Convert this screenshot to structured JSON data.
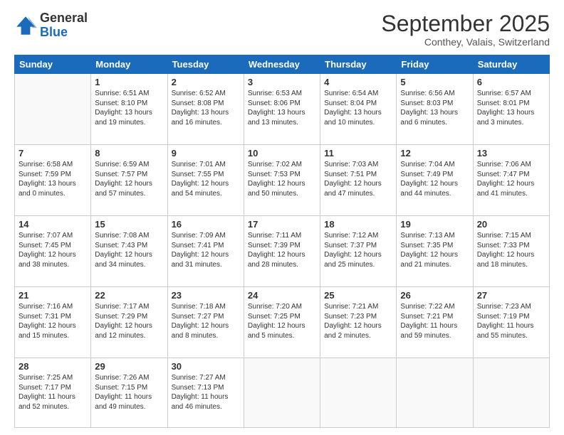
{
  "logo": {
    "general": "General",
    "blue": "Blue"
  },
  "header": {
    "month": "September 2025",
    "location": "Conthey, Valais, Switzerland"
  },
  "days": [
    "Sunday",
    "Monday",
    "Tuesday",
    "Wednesday",
    "Thursday",
    "Friday",
    "Saturday"
  ],
  "weeks": [
    [
      {
        "num": "",
        "sunrise": "",
        "sunset": "",
        "daylight": ""
      },
      {
        "num": "1",
        "sunrise": "Sunrise: 6:51 AM",
        "sunset": "Sunset: 8:10 PM",
        "daylight": "Daylight: 13 hours and 19 minutes."
      },
      {
        "num": "2",
        "sunrise": "Sunrise: 6:52 AM",
        "sunset": "Sunset: 8:08 PM",
        "daylight": "Daylight: 13 hours and 16 minutes."
      },
      {
        "num": "3",
        "sunrise": "Sunrise: 6:53 AM",
        "sunset": "Sunset: 8:06 PM",
        "daylight": "Daylight: 13 hours and 13 minutes."
      },
      {
        "num": "4",
        "sunrise": "Sunrise: 6:54 AM",
        "sunset": "Sunset: 8:04 PM",
        "daylight": "Daylight: 13 hours and 10 minutes."
      },
      {
        "num": "5",
        "sunrise": "Sunrise: 6:56 AM",
        "sunset": "Sunset: 8:03 PM",
        "daylight": "Daylight: 13 hours and 6 minutes."
      },
      {
        "num": "6",
        "sunrise": "Sunrise: 6:57 AM",
        "sunset": "Sunset: 8:01 PM",
        "daylight": "Daylight: 13 hours and 3 minutes."
      }
    ],
    [
      {
        "num": "7",
        "sunrise": "Sunrise: 6:58 AM",
        "sunset": "Sunset: 7:59 PM",
        "daylight": "Daylight: 13 hours and 0 minutes."
      },
      {
        "num": "8",
        "sunrise": "Sunrise: 6:59 AM",
        "sunset": "Sunset: 7:57 PM",
        "daylight": "Daylight: 12 hours and 57 minutes."
      },
      {
        "num": "9",
        "sunrise": "Sunrise: 7:01 AM",
        "sunset": "Sunset: 7:55 PM",
        "daylight": "Daylight: 12 hours and 54 minutes."
      },
      {
        "num": "10",
        "sunrise": "Sunrise: 7:02 AM",
        "sunset": "Sunset: 7:53 PM",
        "daylight": "Daylight: 12 hours and 50 minutes."
      },
      {
        "num": "11",
        "sunrise": "Sunrise: 7:03 AM",
        "sunset": "Sunset: 7:51 PM",
        "daylight": "Daylight: 12 hours and 47 minutes."
      },
      {
        "num": "12",
        "sunrise": "Sunrise: 7:04 AM",
        "sunset": "Sunset: 7:49 PM",
        "daylight": "Daylight: 12 hours and 44 minutes."
      },
      {
        "num": "13",
        "sunrise": "Sunrise: 7:06 AM",
        "sunset": "Sunset: 7:47 PM",
        "daylight": "Daylight: 12 hours and 41 minutes."
      }
    ],
    [
      {
        "num": "14",
        "sunrise": "Sunrise: 7:07 AM",
        "sunset": "Sunset: 7:45 PM",
        "daylight": "Daylight: 12 hours and 38 minutes."
      },
      {
        "num": "15",
        "sunrise": "Sunrise: 7:08 AM",
        "sunset": "Sunset: 7:43 PM",
        "daylight": "Daylight: 12 hours and 34 minutes."
      },
      {
        "num": "16",
        "sunrise": "Sunrise: 7:09 AM",
        "sunset": "Sunset: 7:41 PM",
        "daylight": "Daylight: 12 hours and 31 minutes."
      },
      {
        "num": "17",
        "sunrise": "Sunrise: 7:11 AM",
        "sunset": "Sunset: 7:39 PM",
        "daylight": "Daylight: 12 hours and 28 minutes."
      },
      {
        "num": "18",
        "sunrise": "Sunrise: 7:12 AM",
        "sunset": "Sunset: 7:37 PM",
        "daylight": "Daylight: 12 hours and 25 minutes."
      },
      {
        "num": "19",
        "sunrise": "Sunrise: 7:13 AM",
        "sunset": "Sunset: 7:35 PM",
        "daylight": "Daylight: 12 hours and 21 minutes."
      },
      {
        "num": "20",
        "sunrise": "Sunrise: 7:15 AM",
        "sunset": "Sunset: 7:33 PM",
        "daylight": "Daylight: 12 hours and 18 minutes."
      }
    ],
    [
      {
        "num": "21",
        "sunrise": "Sunrise: 7:16 AM",
        "sunset": "Sunset: 7:31 PM",
        "daylight": "Daylight: 12 hours and 15 minutes."
      },
      {
        "num": "22",
        "sunrise": "Sunrise: 7:17 AM",
        "sunset": "Sunset: 7:29 PM",
        "daylight": "Daylight: 12 hours and 12 minutes."
      },
      {
        "num": "23",
        "sunrise": "Sunrise: 7:18 AM",
        "sunset": "Sunset: 7:27 PM",
        "daylight": "Daylight: 12 hours and 8 minutes."
      },
      {
        "num": "24",
        "sunrise": "Sunrise: 7:20 AM",
        "sunset": "Sunset: 7:25 PM",
        "daylight": "Daylight: 12 hours and 5 minutes."
      },
      {
        "num": "25",
        "sunrise": "Sunrise: 7:21 AM",
        "sunset": "Sunset: 7:23 PM",
        "daylight": "Daylight: 12 hours and 2 minutes."
      },
      {
        "num": "26",
        "sunrise": "Sunrise: 7:22 AM",
        "sunset": "Sunset: 7:21 PM",
        "daylight": "Daylight: 11 hours and 59 minutes."
      },
      {
        "num": "27",
        "sunrise": "Sunrise: 7:23 AM",
        "sunset": "Sunset: 7:19 PM",
        "daylight": "Daylight: 11 hours and 55 minutes."
      }
    ],
    [
      {
        "num": "28",
        "sunrise": "Sunrise: 7:25 AM",
        "sunset": "Sunset: 7:17 PM",
        "daylight": "Daylight: 11 hours and 52 minutes."
      },
      {
        "num": "29",
        "sunrise": "Sunrise: 7:26 AM",
        "sunset": "Sunset: 7:15 PM",
        "daylight": "Daylight: 11 hours and 49 minutes."
      },
      {
        "num": "30",
        "sunrise": "Sunrise: 7:27 AM",
        "sunset": "Sunset: 7:13 PM",
        "daylight": "Daylight: 11 hours and 46 minutes."
      },
      {
        "num": "",
        "sunrise": "",
        "sunset": "",
        "daylight": ""
      },
      {
        "num": "",
        "sunrise": "",
        "sunset": "",
        "daylight": ""
      },
      {
        "num": "",
        "sunrise": "",
        "sunset": "",
        "daylight": ""
      },
      {
        "num": "",
        "sunrise": "",
        "sunset": "",
        "daylight": ""
      }
    ]
  ]
}
